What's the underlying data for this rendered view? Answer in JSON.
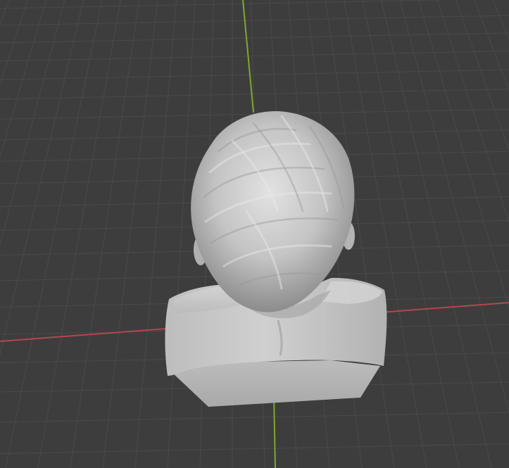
{
  "viewport": {
    "background_color": "#3d3d3d",
    "grid_minor_color": "#4a4a4a",
    "grid_major_color": "#505050",
    "x_axis_color": "#b5454f",
    "y_axis_color": "#7fa82e",
    "model_name": "bust-sculpt"
  },
  "model": {
    "base_color": "#c9c9c9",
    "shadow_color": "#8a8a8a",
    "highlight_color": "#e6e6e6"
  }
}
